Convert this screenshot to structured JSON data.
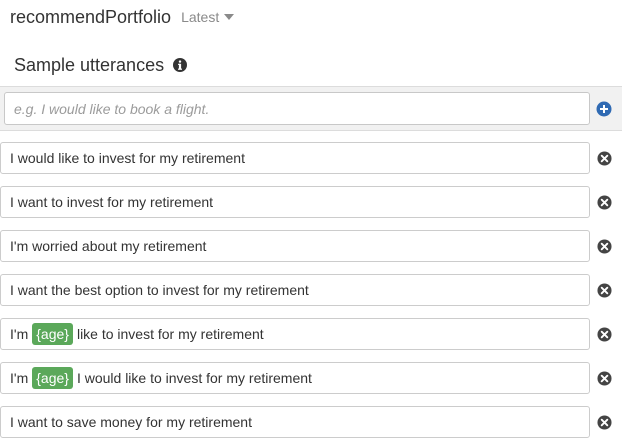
{
  "intent": {
    "name": "recommendPortfolio",
    "version": "Latest"
  },
  "section": {
    "title": "Sample utterances",
    "info_icon": "info-icon"
  },
  "add_utterance": {
    "placeholder": "e.g. I would like to book a flight.",
    "value": "",
    "add_icon": "plus-circle-icon"
  },
  "utterances": [
    {
      "parts": [
        {
          "text": "I would like to invest for my retirement"
        }
      ]
    },
    {
      "parts": [
        {
          "text": "I want to invest for my retirement"
        }
      ]
    },
    {
      "parts": [
        {
          "text": "I'm worried about my retirement"
        }
      ]
    },
    {
      "parts": [
        {
          "text": "I want the best option to invest for my retirement"
        }
      ]
    },
    {
      "parts": [
        {
          "text": "I'm"
        },
        {
          "slot": "{age}"
        },
        {
          "text": "like to invest for my retirement"
        }
      ]
    },
    {
      "parts": [
        {
          "text": "I'm"
        },
        {
          "slot": "{age}"
        },
        {
          "text": "I would like to invest for my retirement"
        }
      ]
    },
    {
      "parts": [
        {
          "text": "I want to save money for my retirement"
        }
      ]
    }
  ],
  "colors": {
    "slot_bg": "#5ba85a",
    "add_icon": "#2f6ab3",
    "remove_icon": "#444444"
  }
}
